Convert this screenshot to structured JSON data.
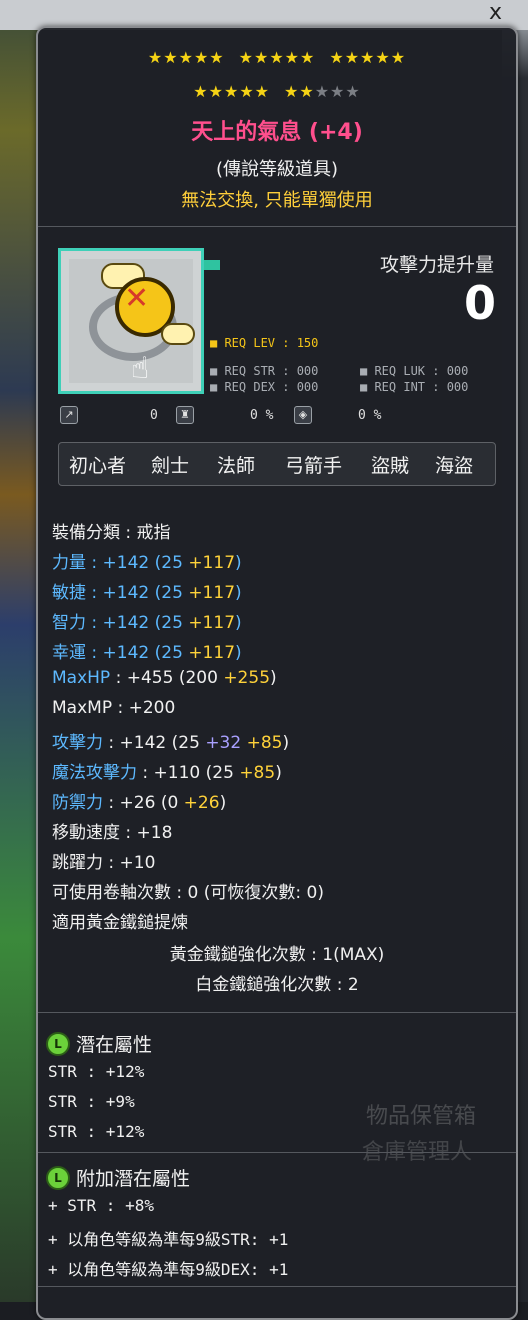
{
  "window": {
    "close_glyph": "x"
  },
  "stars": {
    "row1": [
      "on",
      "on",
      "on",
      "on",
      "on",
      "gap",
      "on",
      "on",
      "on",
      "on",
      "on",
      "gap",
      "on",
      "on",
      "on",
      "on",
      "on"
    ],
    "row2": [
      "on",
      "on",
      "on",
      "on",
      "on",
      "gap",
      "on",
      "on",
      "off",
      "off",
      "off"
    ]
  },
  "item": {
    "name": "天上的氣息 (+4)",
    "grade": "(傳說等級道具)",
    "trade_note": "無法交換, 只能單獨使用",
    "attack_increase_label": "攻擊力提升量",
    "attack_increase_value": "0",
    "req_lev": "■ REQ LEV : 150",
    "req_str": "■ REQ STR : 000",
    "req_luk": "■ REQ LUK : 000",
    "req_dex": "■ REQ DEX : 000",
    "req_int": "■ REQ INT : 000",
    "pct_1": "0",
    "pct_2": "0 %",
    "pct_3": "0 %"
  },
  "jobs": [
    "初心者",
    "劍士",
    "法師",
    "弓箭手",
    "盜賊",
    "海盜"
  ],
  "stats": {
    "category": "裝備分類 : 戒指",
    "str": {
      "label": "力量",
      "value": " : +142 (25 ",
      "bonus": "+117",
      "close": ")"
    },
    "dex": {
      "label": "敏捷",
      "value": " : +142 (25 ",
      "bonus": "+117",
      "close": ")"
    },
    "int": {
      "label": "智力",
      "value": " : +142 (25 ",
      "bonus": "+117",
      "close": ")"
    },
    "luk": {
      "label": "幸運",
      "value": " : +142 (25 ",
      "bonus": "+117",
      "close": ")"
    },
    "maxhp": {
      "label": "MaxHP",
      "value": " : +455 (200 ",
      "bonus": "+255",
      "close": ")"
    },
    "maxmp": "MaxMP : +200",
    "atk": {
      "label": "攻擊力",
      "value": " : +142 (25 ",
      "bonus_violet": "+32",
      "bonus": "+85",
      "close": ")"
    },
    "matk": {
      "label": "魔法攻擊力",
      "value": " : +110 (25 ",
      "bonus": "+85",
      "close": ")"
    },
    "def": {
      "label": "防禦力",
      "value": " : +26 (0 ",
      "bonus": "+26",
      "close": ")"
    },
    "speed": "移動速度 : +18",
    "jump": "跳躍力 : +10",
    "upgrades": "可使用卷軸次數 : 0 (可恢復次數: 0)",
    "hammer": "適用黃金鐵鎚提煉",
    "gold_hammer": "黃金鐵鎚強化次數 : 1(MAX)",
    "plat_hammer": "白金鐵鎚強化次數 : 2"
  },
  "potential": {
    "badge": "L",
    "title": "潛在屬性",
    "lines": [
      "STR : +12%",
      "STR : +9%",
      "STR : +12%"
    ]
  },
  "additional": {
    "badge": "L",
    "title": "附加潛在屬性",
    "lines": [
      "+ STR : +8%",
      "+ 以角色等級為準每9級STR: +1",
      "+ 以角色等級為準每9級DEX: +1"
    ]
  },
  "background": {
    "stamp1": "物品保管箱",
    "stamp2": "倉庫管理人"
  },
  "colors": {
    "title": "#ff4f8d",
    "trade_note": "#ffcf3a",
    "stat_label_blue": "#5db9ff",
    "bonus_yellow": "#ffd23a",
    "bonus_violet": "#a9a0ff",
    "potential_badge": "#6bd13a",
    "icon_border": "#3fd0b8"
  }
}
